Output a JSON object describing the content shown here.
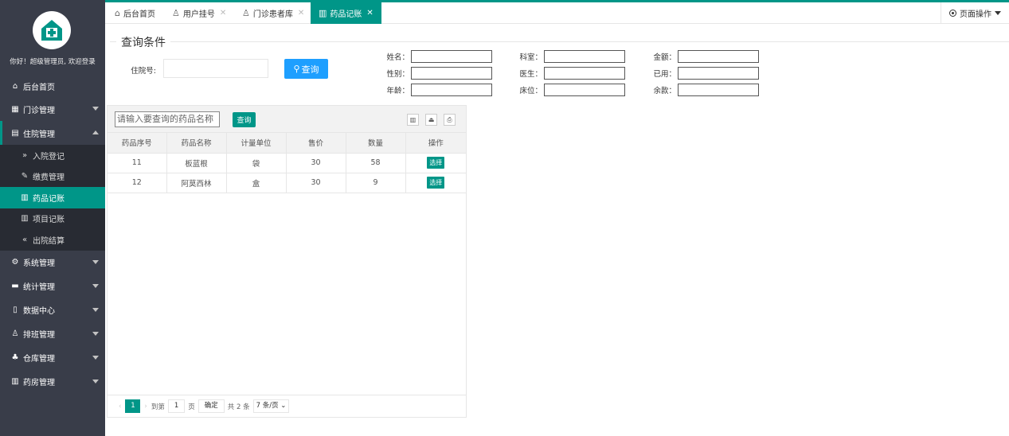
{
  "sidebar": {
    "welcome": "你好！超级管理员, 欢迎登录",
    "items": [
      {
        "label": "后台首页",
        "icon": "home-icon"
      },
      {
        "label": "门诊管理",
        "icon": "grid-icon"
      },
      {
        "label": "住院管理",
        "icon": "building-icon"
      },
      {
        "label": "入院登记",
        "icon": "double-chevron-right-icon"
      },
      {
        "label": "缴费管理",
        "icon": "edit-icon"
      },
      {
        "label": "药品记账",
        "icon": "book-icon"
      },
      {
        "label": "项目记账",
        "icon": "book-icon"
      },
      {
        "label": "出院结算",
        "icon": "double-chevron-left-icon"
      },
      {
        "label": "系统管理",
        "icon": "gear-icon"
      },
      {
        "label": "统计管理",
        "icon": "chat-icon"
      },
      {
        "label": "数据中心",
        "icon": "file-icon"
      },
      {
        "label": "排班管理",
        "icon": "user-icon"
      },
      {
        "label": "仓库管理",
        "icon": "warehouse-icon"
      },
      {
        "label": "药房管理",
        "icon": "book-icon"
      }
    ]
  },
  "tabs": [
    {
      "label": "后台首页",
      "icon": "home-icon"
    },
    {
      "label": "用户挂号",
      "icon": "user-icon"
    },
    {
      "label": "门诊患者库",
      "icon": "user-icon"
    },
    {
      "label": "药品记账",
      "icon": "book-icon"
    }
  ],
  "page_ops": "页面操作",
  "query": {
    "legend": "查询条件",
    "hosp_no_label": "住院号:",
    "button": "查询",
    "fields": [
      "姓名：",
      "科室：",
      "金额：",
      "性别：",
      "医生：",
      "已用：",
      "年龄：",
      "床位：",
      "余款："
    ]
  },
  "table": {
    "search_placeholder": "请输入要查询的药品名称",
    "search_button": "查询",
    "headers": [
      "药品序号",
      "药品名称",
      "计量单位",
      "售价",
      "数量",
      "操作"
    ],
    "rows": [
      {
        "id": "11",
        "name": "板蓝根",
        "unit": "袋",
        "price": "30",
        "qty": "58",
        "action": "选择"
      },
      {
        "id": "12",
        "name": "阿莫西林",
        "unit": "盒",
        "price": "30",
        "qty": "9",
        "action": "选择"
      }
    ]
  },
  "pager": {
    "current": "1",
    "goto_label": "到第",
    "goto_value": "1",
    "page_label": "页",
    "confirm": "确定",
    "total": "共 2 条",
    "per_page": "7 条/页"
  },
  "colors": {
    "accent": "#009688",
    "sidebar": "#393d49",
    "blue": "#1e9fff"
  }
}
